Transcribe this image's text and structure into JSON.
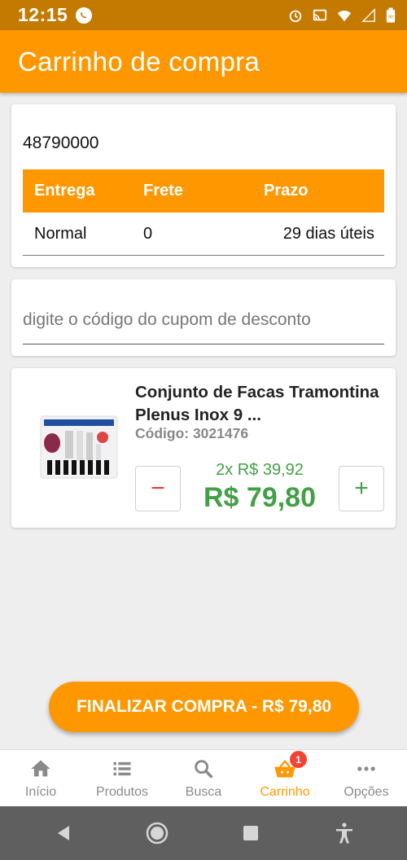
{
  "status": {
    "time": "12:15",
    "battery": "90"
  },
  "app": {
    "title": "Carrinho de compra"
  },
  "shipping": {
    "cep": "48790000",
    "headers": [
      "Entrega",
      "Frete",
      "Prazo"
    ],
    "row": [
      "Normal",
      "0",
      "29 dias úteis"
    ]
  },
  "coupon": {
    "placeholder": "digite o código do cupom de desconto",
    "value": ""
  },
  "product": {
    "name": "Conjunto de Facas Tramontina Plenus Inox 9 ...",
    "code": "Código: 3021476",
    "unit_price": "2x R$ 39,92",
    "total": "R$ 79,80",
    "minus_label": "−",
    "plus_label": "+"
  },
  "checkout": {
    "label": "FINALIZAR COMPRA - R$ 79,80"
  },
  "nav": {
    "items": [
      {
        "label": "Início",
        "icon": "home-icon"
      },
      {
        "label": "Produtos",
        "icon": "list-icon"
      },
      {
        "label": "Busca",
        "icon": "search-icon"
      },
      {
        "label": "Carrinho",
        "icon": "basket-icon",
        "badge": "1"
      },
      {
        "label": "Opções",
        "icon": "more-icon"
      }
    ]
  },
  "colors": {
    "accent": "#ff9800",
    "status_bar": "#c47a00",
    "price": "#43a047",
    "minus": "#e53935",
    "badge": "#f44336"
  }
}
